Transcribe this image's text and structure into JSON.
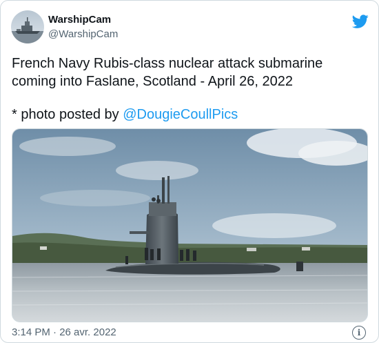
{
  "tweet": {
    "author": {
      "display_name": "WarshipCam",
      "handle": "@WarshipCam",
      "avatar_icon": "warship-avatar"
    },
    "brand_icon": "twitter-bird-icon",
    "brand_color": "#1d9bf0",
    "text_line_1": "French Navy Rubis-class nuclear attack submarine coming into Faslane, Scotland - April 26, 2022",
    "text_line_2_prefix": "* photo posted by ",
    "text_line_2_mention": "@DougieCoullPics",
    "media": {
      "icon": "submarine-photo"
    },
    "timestamp": "3:14 PM · 26 avr. 2022",
    "info_icon": "info-icon",
    "info_glyph": "i"
  }
}
